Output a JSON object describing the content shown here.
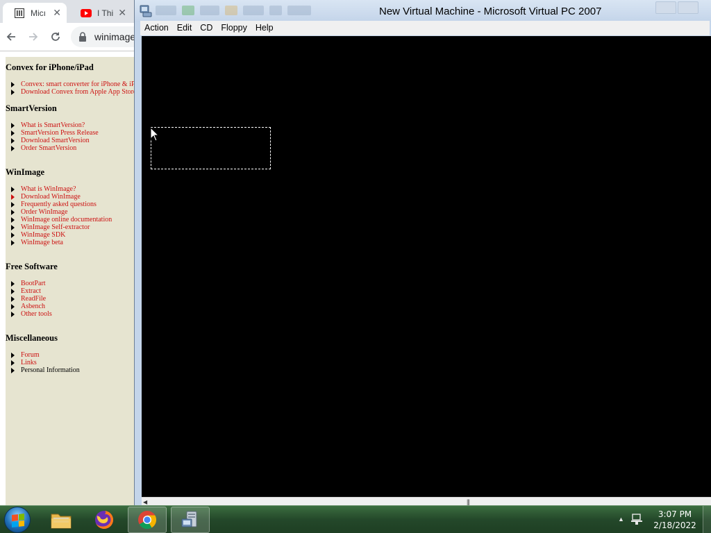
{
  "browser": {
    "tabs": [
      {
        "title": "Micı",
        "favicon": "library-icon"
      },
      {
        "title": "I Thi",
        "favicon": "youtube-icon"
      }
    ],
    "address": "winimage"
  },
  "webpage": {
    "sections": [
      {
        "title": "Convex for iPhone/iPad",
        "links": [
          {
            "label": "Convex: smart converter for iPhone & iPad"
          },
          {
            "label": "Download Convex from Apple App Store"
          }
        ]
      },
      {
        "title": "SmartVersion",
        "links": [
          {
            "label": "What is SmartVersion?"
          },
          {
            "label": "SmartVersion Press Release"
          },
          {
            "label": "Download SmartVersion"
          },
          {
            "label": "Order SmartVersion"
          }
        ]
      },
      {
        "title": "WinImage",
        "links": [
          {
            "label": "What is WinImage?"
          },
          {
            "label": "Download WinImage"
          },
          {
            "label": "Frequently asked questions"
          },
          {
            "label": "Order WinImage"
          },
          {
            "label": "WinImage online documentation"
          },
          {
            "label": "WinImage Self-extractor"
          },
          {
            "label": "WinImage SDK"
          },
          {
            "label": "WinImage beta"
          }
        ]
      },
      {
        "title": "Free Software",
        "links": [
          {
            "label": "BootPart"
          },
          {
            "label": "Extract"
          },
          {
            "label": "ReadFile"
          },
          {
            "label": "Asbench"
          },
          {
            "label": "Other tools"
          }
        ]
      },
      {
        "title": "Miscellaneous",
        "links": [
          {
            "label": "Forum"
          },
          {
            "label": "Links"
          },
          {
            "label": "Personal Information"
          }
        ]
      }
    ]
  },
  "vpc": {
    "title": "New Virtual Machine - Microsoft Virtual PC 2007",
    "menus": [
      "Action",
      "Edit",
      "CD",
      "Floppy",
      "Help"
    ]
  },
  "taskbar": {
    "time": "3:07 PM",
    "date": "2/18/2022",
    "pinned": [
      "windows-explorer-icon",
      "firefox-icon",
      "chrome-icon",
      "virtual-pc-icon"
    ]
  },
  "colors": {
    "link": "#cc1111",
    "sidebar_bg": "#e6e4d0",
    "taskbar": "#24482a",
    "vm_screen": "#000000"
  }
}
